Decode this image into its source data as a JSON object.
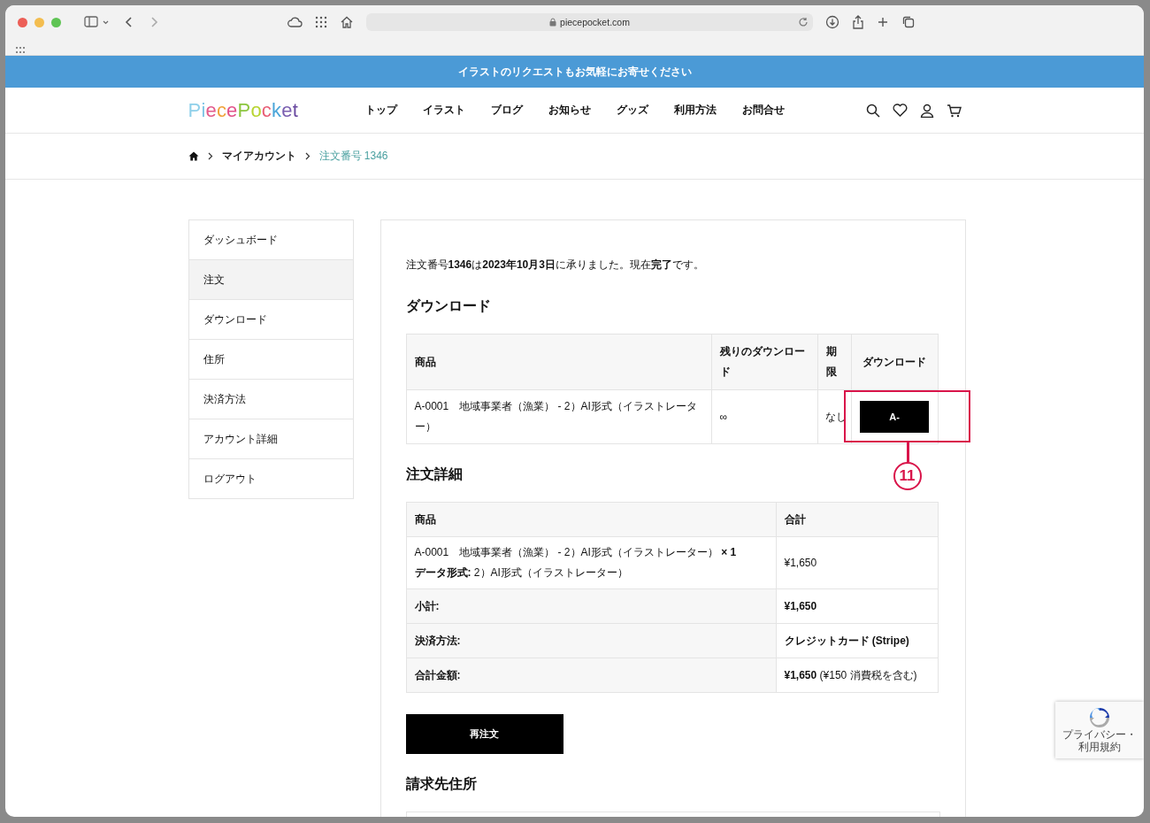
{
  "browser": {
    "url": "piecepocket.com"
  },
  "banner": {
    "text": "イラストのリクエストもお気軽にお寄せください"
  },
  "header": {
    "logo": "PiecePocket",
    "nav": [
      "トップ",
      "イラスト",
      "ブログ",
      "お知らせ",
      "グッズ",
      "利用方法",
      "お問合せ"
    ]
  },
  "breadcrumb": {
    "items": [
      "マイアカウント"
    ],
    "current": "注文番号 1346"
  },
  "sidebar": {
    "items": [
      {
        "label": "ダッシュボード",
        "selected": false
      },
      {
        "label": "注文",
        "selected": true
      },
      {
        "label": "ダウンロード",
        "selected": false
      },
      {
        "label": "住所",
        "selected": false
      },
      {
        "label": "決済方法",
        "selected": false
      },
      {
        "label": "アカウント詳細",
        "selected": false
      },
      {
        "label": "ログアウト",
        "selected": false
      }
    ]
  },
  "order": {
    "intro": "注文番号**1346**は**2023年10月3日**に承りました。現在**完了**です。",
    "downloads": {
      "title": "ダウンロード",
      "columns": [
        "商品",
        "残りのダウンロード",
        "期限",
        "ダウンロード"
      ],
      "rows": [
        {
          "product": "A-0001　地域事業者（漁業） - 2）AI形式（イラストレーター）",
          "remaining": "∞",
          "expires": "なし",
          "button": "A-"
        }
      ]
    },
    "callout": "11",
    "details": {
      "title": "注文詳細",
      "columns": [
        "商品",
        "合計"
      ],
      "item": {
        "name": "A-0001　地域事業者（漁業） - 2）AI形式（イラストレーター） **× 1**",
        "meta": "**データ形式:** 2）AI形式（イラストレーター）",
        "total": "¥1,650"
      },
      "summary": [
        {
          "label": "小計:",
          "value": "**¥1,650**"
        },
        {
          "label": "決済方法:",
          "value": "**クレジットカード (Stripe)**"
        },
        {
          "label": "合計金額:",
          "value": "**¥1,650** (¥150 消費税を含む)"
        }
      ]
    },
    "reorder_button": "再注文",
    "billing_title": "請求先住所"
  },
  "recaptcha": {
    "text": "プライバシー・利用規約"
  }
}
